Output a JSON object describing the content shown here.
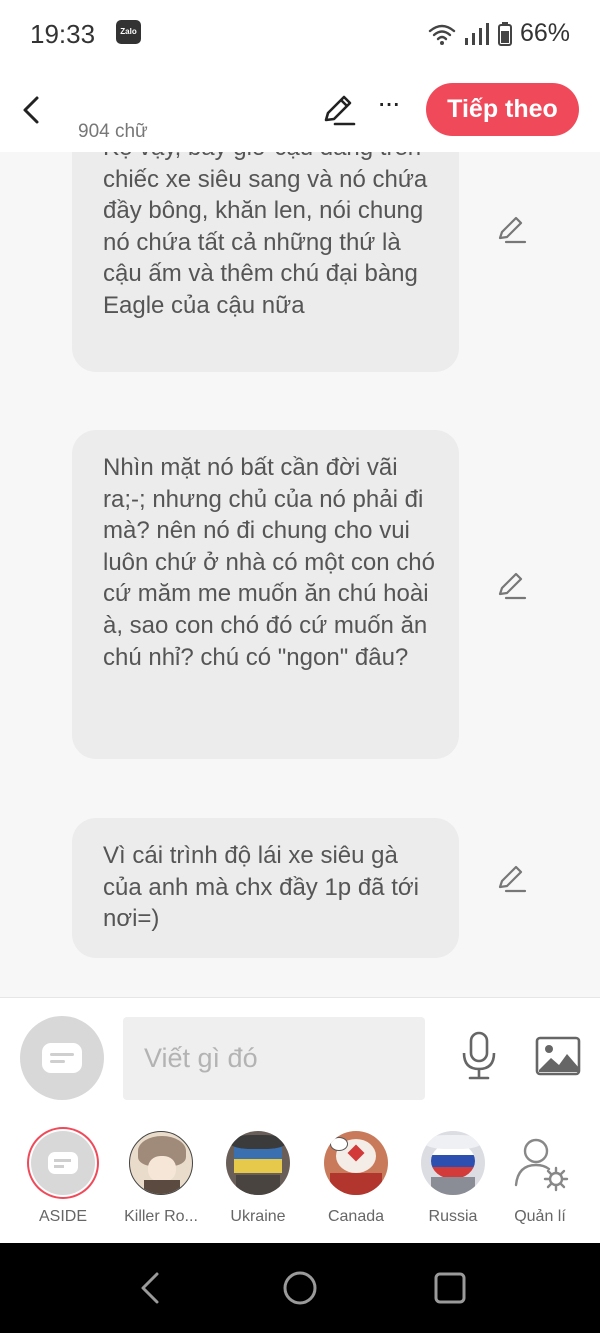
{
  "status": {
    "time": "19:33",
    "battery": "66%",
    "notification_app": "Zalo"
  },
  "header": {
    "word_count": "904 chữ",
    "next_label": "Tiếp theo"
  },
  "messages": [
    {
      "text": "Kệ vậy, bây giờ cậu đang trên chiếc xe siêu sang và nó chứa đầy bông, khăn len, nói chung nó chứa tất cả những thứ là cậu ấm và thêm chú đại bàng Eagle của cậu nữa"
    },
    {
      "text": "Nhìn mặt nó bất cần đời vãi ra;-; nhưng chủ của nó phải đi mà? nên nó đi chung cho vui luôn chứ ở nhà có một con chó cứ măm me muốn ăn chú hoài à, sao con chó đó cứ muốn ăn chú nhỉ? chú có \"ngon\" đâu?"
    },
    {
      "text": "Vì cái trình độ lái xe siêu gà của anh mà chx đầy 1p đã tới nơi=)"
    }
  ],
  "composer": {
    "placeholder": "Viết gì đó"
  },
  "characters": [
    {
      "label": "ASIDE"
    },
    {
      "label": "Killer Ro..."
    },
    {
      "label": "Ukraine"
    },
    {
      "label": "Canada"
    },
    {
      "label": "Russia"
    },
    {
      "label": "Quản lí"
    }
  ],
  "colors": {
    "accent": "#f04a5a",
    "bubble": "#ececec",
    "background": "#f7f7f7"
  }
}
